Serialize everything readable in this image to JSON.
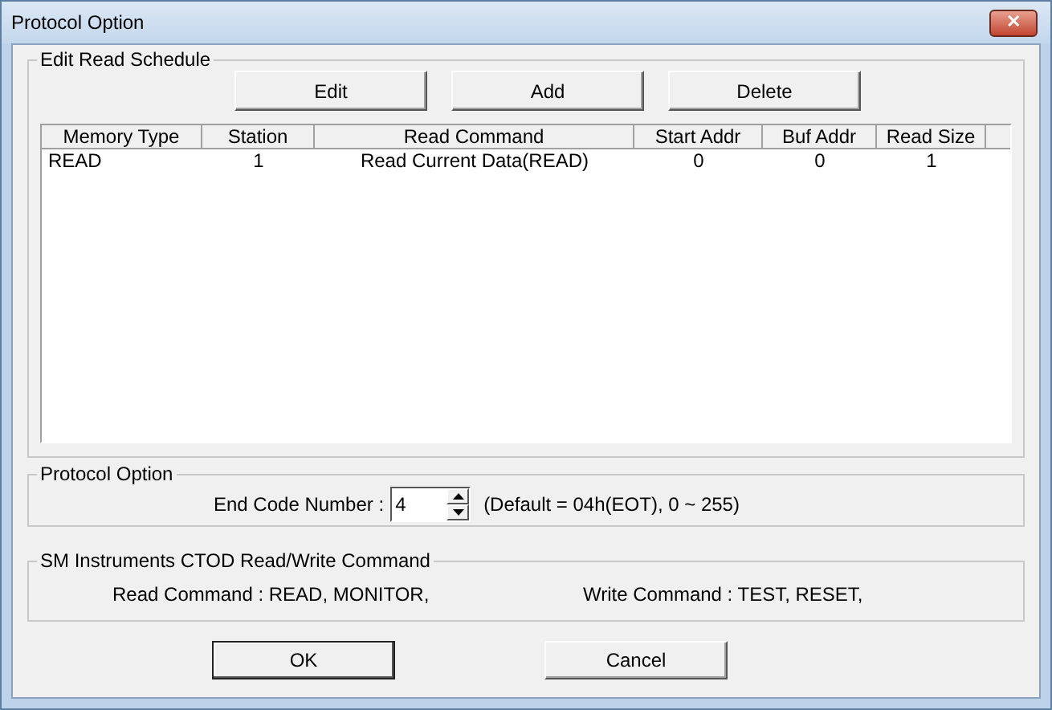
{
  "window": {
    "title": "Protocol Option",
    "close": "✕"
  },
  "schedule": {
    "title": "Edit Read Schedule",
    "buttons": [
      "Edit",
      "Add",
      "Delete"
    ],
    "columns": [
      "Memory Type",
      "Station",
      "Read Command",
      "Start Addr",
      "Buf Addr",
      "Read Size"
    ],
    "rows": [
      [
        "READ",
        "1",
        "Read Current Data(READ)",
        "0",
        "0",
        "1"
      ]
    ]
  },
  "protocol": {
    "title": "Protocol Option",
    "label": "End Code Number :",
    "value": "4",
    "note": "(Default = 04h(EOT), 0 ~ 255)"
  },
  "commands": {
    "title": "SM Instruments CTOD Read/Write Command",
    "read": "Read Command : READ, MONITOR,",
    "write": "Write Command : TEST, RESET,"
  },
  "buttons": [
    "OK",
    "Cancel"
  ]
}
